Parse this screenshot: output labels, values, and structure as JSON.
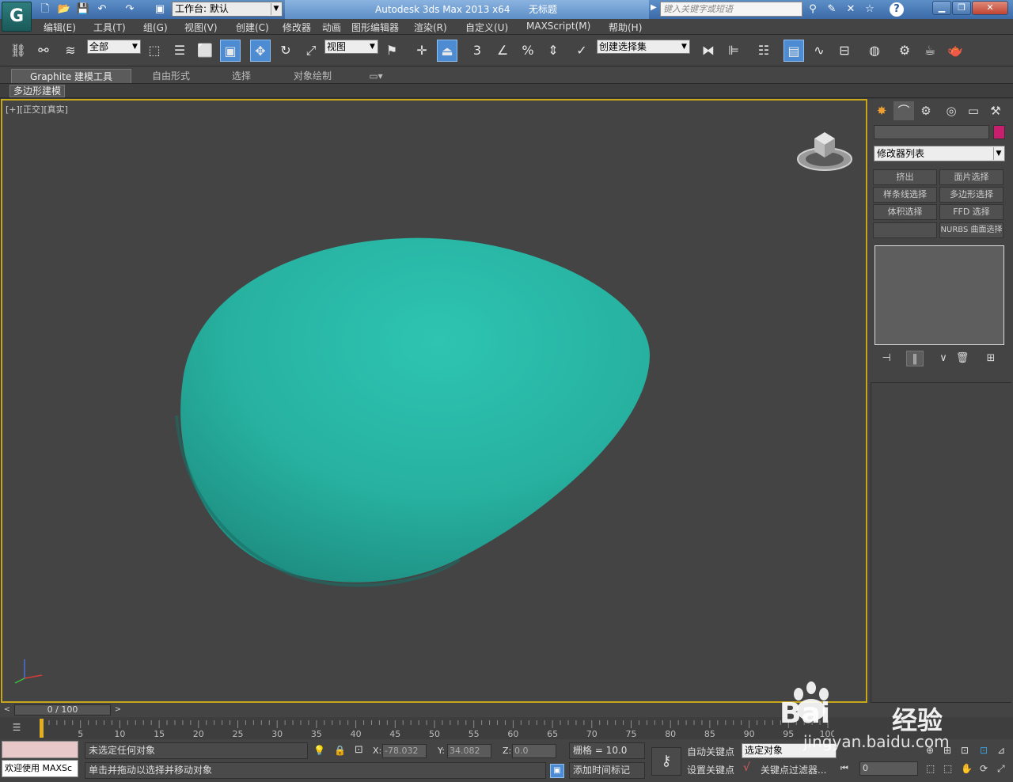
{
  "titlebar": {
    "logo": "G",
    "workspace_label": "工作台: 默认",
    "app_title": "Autodesk 3ds Max  2013 x64",
    "doc_title": "无标题",
    "search_placeholder": "键入关键字或短语",
    "help_label": "?"
  },
  "menu": [
    "编辑(E)",
    "工具(T)",
    "组(G)",
    "视图(V)",
    "创建(C)",
    "修改器",
    "动画",
    "图形编辑器",
    "渲染(R)",
    "自定义(U)",
    "MAXScript(M)",
    "帮助(H)"
  ],
  "toolbar": {
    "selection_filter": "全部",
    "ref_coord": "视图",
    "named_selection": "创建选择集",
    "snap_3": "3",
    "angle_snap": "∠",
    "percent_snap": "%"
  },
  "ribbon": {
    "tabs": [
      "Graphite 建模工具",
      "自由形式",
      "选择",
      "对象绘制"
    ],
    "sub_label": "多边形建模"
  },
  "viewport": {
    "label": "[+][正交][真实]",
    "object_color": "#2ebfab"
  },
  "command_panel": {
    "modifier_list": "修改器列表",
    "buttons": [
      "挤出",
      "面片选择",
      "样条线选择",
      "多边形选择",
      "体积选择",
      "FFD 选择",
      "",
      "NURBS 曲面选择"
    ]
  },
  "timeslider": {
    "frame_display": "0 / 100",
    "prev": "<",
    "next": ">"
  },
  "timeline_ticks": [
    "0",
    "5",
    "10",
    "15",
    "20",
    "25",
    "30",
    "35",
    "40",
    "45",
    "50",
    "55",
    "60",
    "65",
    "70",
    "75",
    "80",
    "85",
    "90",
    "95",
    "100"
  ],
  "status": {
    "maxscript_label": "欢迎使用 MAXSc",
    "selection_status": "未选定任何对象",
    "prompt": "单击并拖动以选择并移动对象",
    "x_label": "X:",
    "x_value": "-78.032",
    "y_label": "Y:",
    "y_value": "34.082",
    "z_label": "Z:",
    "z_value": "0.0",
    "grid": "栅格 = 10.0",
    "add_time_tag": "添加时间标记",
    "auto_key": "自动关键点",
    "set_key": "设置关键点",
    "selected_object": "选定对象",
    "key_filters": "关键点过滤器...",
    "current_frame": "0"
  },
  "watermark": {
    "brand": "Bai",
    "brand2": "经验",
    "url": "jingyan.baidu.com"
  }
}
